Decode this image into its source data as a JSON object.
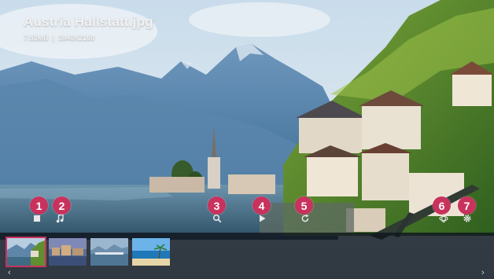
{
  "file": {
    "name": "Austria Hallstatt.jpg",
    "size": "7.53MB",
    "separator": "|",
    "resolution": "3840X2160"
  },
  "controls": [
    {
      "icon": "stop-icon",
      "badge": "1"
    },
    {
      "icon": "music-note-icon",
      "badge": "2"
    },
    {
      "icon": "zoom-icon",
      "badge": "3"
    },
    {
      "icon": "play-icon",
      "badge": "4"
    },
    {
      "icon": "rotate-icon",
      "badge": "5"
    },
    {
      "icon": "360-view-icon",
      "badge": "6"
    },
    {
      "icon": "settings-icon",
      "badge": "7"
    }
  ],
  "thumbnails": [
    {
      "subject": "hallstatt-lake-village",
      "selected": true
    },
    {
      "subject": "town-dusk",
      "selected": false
    },
    {
      "subject": "lake-mountains",
      "selected": false
    },
    {
      "subject": "tropical-beach",
      "selected": false
    }
  ],
  "nav": {
    "prev": "‹",
    "next": "›"
  },
  "colors": {
    "accent": "#c8325d",
    "bar": "#10161e"
  }
}
